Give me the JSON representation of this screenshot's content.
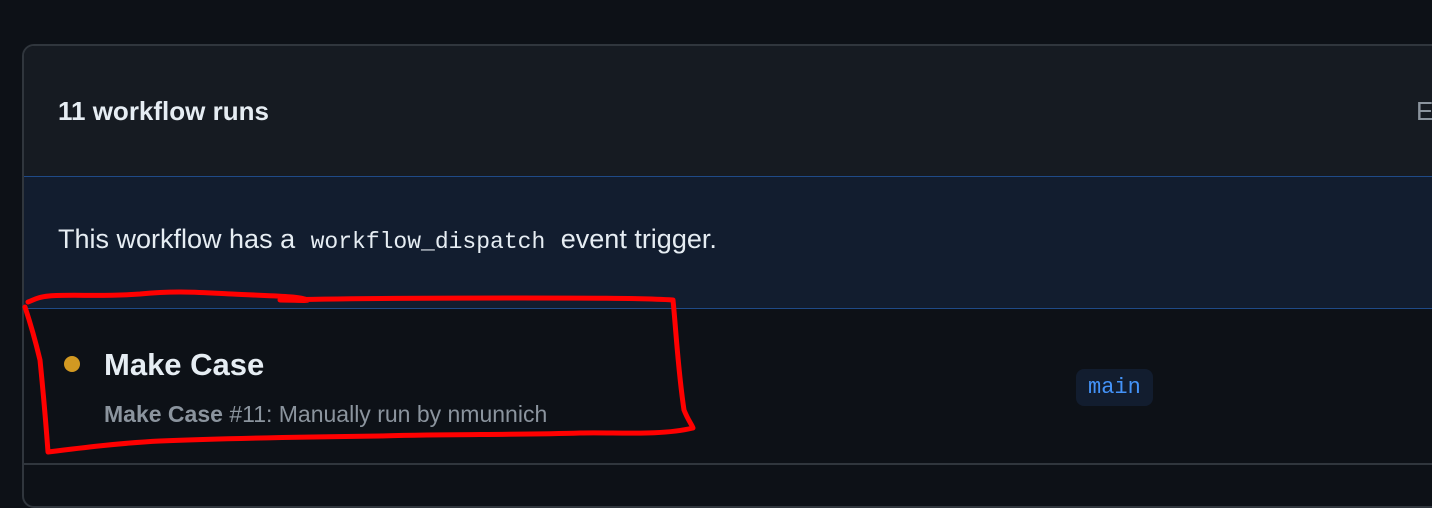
{
  "header": {
    "title": "11 workflow runs",
    "right_clipped_text": "E"
  },
  "banner": {
    "text_before": "This workflow has a",
    "code": "workflow_dispatch",
    "text_after": "event trigger."
  },
  "runs": [
    {
      "status_color": "#d29922",
      "title": "Make Case",
      "workflow_name": "Make Case",
      "detail": "#11: Manually run by nmunnich",
      "branch": "main"
    }
  ],
  "colors": {
    "background": "#0d1117",
    "header_background": "#161b22",
    "banner_background": "#121d2f",
    "border": "#30363d",
    "accent_blue": "#4493f8",
    "annotation_red": "#ff0000"
  }
}
